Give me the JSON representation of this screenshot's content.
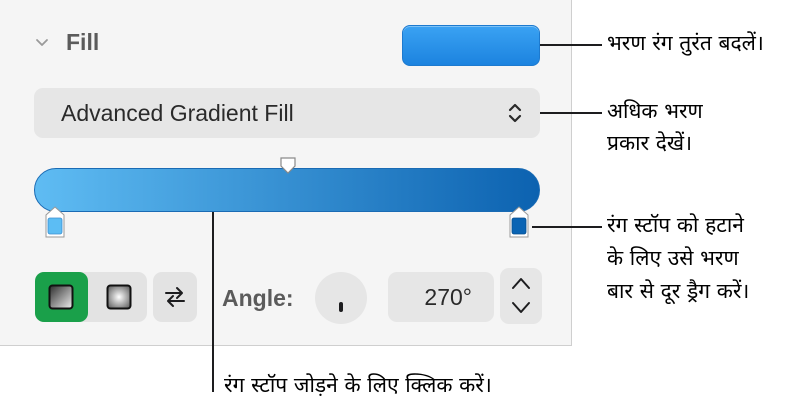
{
  "fill_panel": {
    "section_title": "Fill",
    "fill_color": "#2a93ea",
    "fill_type_selected": "Advanced Gradient Fill",
    "gradient": {
      "start_color": "#5fbcf3",
      "end_color": "#0c62b0",
      "left_stop_color": "#5cbdf4",
      "right_stop_color": "#0a64b4"
    },
    "gradient_style_active": "linear",
    "angle_label": "Angle:",
    "angle_value": "270°",
    "active_accent": "#1aa04a"
  },
  "callouts": {
    "color_well": "भरण रंग तुरंत बदलें।",
    "fill_types_line1": "अधिक भरण",
    "fill_types_line2": "प्रकार देखें।",
    "remove_stop_line1": "रंग स्टॉप को हटाने",
    "remove_stop_line2": "के लिए उसे भरण",
    "remove_stop_line3": "बार से दूर ड्रैग करें।",
    "add_stop": "रंग स्टॉप जोड़ने के लिए क्लिक करें।"
  },
  "icons": [
    "chevron-down-icon",
    "select-arrows-icon",
    "swap-icon",
    "stepper-up-icon",
    "stepper-down-icon"
  ]
}
